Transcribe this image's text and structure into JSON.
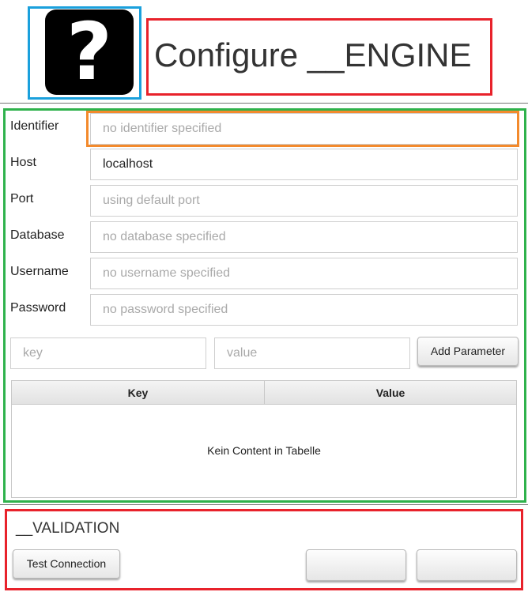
{
  "header": {
    "icon": "question-mark-icon",
    "icon_glyph": "?",
    "title": "Configure __ENGINE"
  },
  "form": {
    "fields": [
      {
        "label": "Identifier",
        "value": "",
        "placeholder": "no identifier specified"
      },
      {
        "label": "Host",
        "value": "localhost",
        "placeholder": ""
      },
      {
        "label": "Port",
        "value": "",
        "placeholder": "using default port"
      },
      {
        "label": "Database",
        "value": "",
        "placeholder": "no database specified"
      },
      {
        "label": "Username",
        "value": "",
        "placeholder": "no username specified"
      },
      {
        "label": "Password",
        "value": "",
        "placeholder": "no password specified"
      }
    ],
    "parameters": {
      "key_placeholder": "key",
      "value_placeholder": "value",
      "add_button_label": "Add Parameter",
      "table": {
        "columns": [
          "Key",
          "Value"
        ],
        "rows": [],
        "empty_text": "Kein Content in Tabelle"
      }
    }
  },
  "validation": {
    "title": "__VALIDATION",
    "test_button_label": "Test Connection",
    "button_2_label": "",
    "button_3_label": ""
  },
  "colors": {
    "icon_frame": "#1aa0dc",
    "title_frame": "#e8222b",
    "form_frame": "#2fb24c",
    "identifier_frame": "#f38a2c",
    "validation_frame": "#e8222b"
  }
}
